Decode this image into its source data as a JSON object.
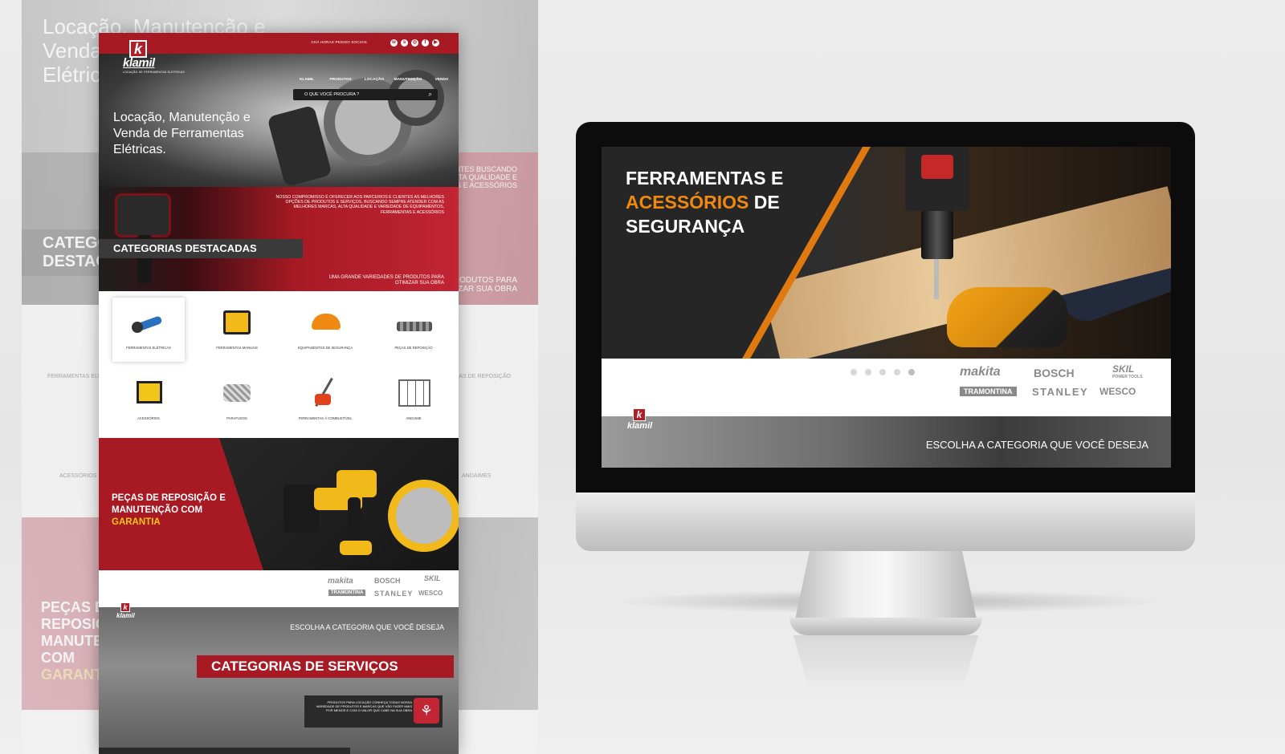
{
  "ghost": {
    "hero_title": "Locação, Manutenção e Venda de Ferramentas Elétricas.",
    "categories_title": "CATEGORIAS DESTACADAS",
    "red_text": "PARCEIROS E CLIENTES BUSCANDO SEMPRE ALTA QUALIDADE E FERRAMENTAS E ACESSÓRIOS",
    "red_text2": "VARIEDADES DE PRODUTOS PARA OTIMIZAR SUA OBRA",
    "labels": [
      "FERRAMENTAS ELÉTRICAS",
      "PEÇAS DE REPOSIÇÃO",
      "ACESSÓRIOS",
      "ANDAIMES"
    ],
    "parts_title": "PEÇAS DE REPOSIÇÃO E MANUTENÇÃO COM",
    "parts_gold": "GARANTIA"
  },
  "page": {
    "topbar_text": "CHÁ HORAS PEDIDO SOCIAIS",
    "social_icons": [
      "whatsapp-icon",
      "skype-icon",
      "instagram-icon",
      "facebook-icon",
      "youtube-icon"
    ],
    "social_glyphs": [
      "w",
      "s",
      "◎",
      "f",
      "▶"
    ],
    "logo": {
      "mark": "k",
      "name": "klamil",
      "tagline": "LOCAÇÃO DE FERRAMENTAS ELÉTRICAS"
    },
    "nav": [
      "KLAMIL",
      "PRODUTOS",
      "LOCAÇÃO",
      "MANUTENÇÃO",
      "VENDA"
    ],
    "search": {
      "placeholder": "O QUE VOCÊ PROCURA ?",
      "icon": "search-icon"
    },
    "hero_title": "Locação, Manutenção e Venda de Ferramentas Elétricas.",
    "red_text": "NOSSO COMPROMISSO É OFERECER AOS PARCEIROS E CLIENTES AS MELHORES OPÇÕES DE PRODUTOS E SERVIÇOS, BUSCANDO SEMPRE ATENDER COM AS MELHORES MARCAS, ALTA QUALIDADE E VARIEDADE DE EQUIPAMENTOS, FERRAMENTAS E ACESSÓRIOS",
    "categories_title": "CATEGORIAS DESTACADAS",
    "red_text2": "UMA GRANDE VARIEDADES DE PRODUTOS PARA OTIMIZAR SUA OBRA",
    "categories": [
      {
        "label": "FERRAMENTAS ELÉTRICAS",
        "icon": "angle-grinder-icon"
      },
      {
        "label": "FERRAMENTAS MANUAIS",
        "icon": "toolbox-icon"
      },
      {
        "label": "EQUIPAMENTOS DE SEGURANÇA",
        "icon": "safety-helmet-icon"
      },
      {
        "label": "PEÇAS DE REPOSIÇÃO",
        "icon": "spare-parts-icon"
      },
      {
        "label": "ACESSÓRIOS",
        "icon": "generator-icon"
      },
      {
        "label": "PARAFUSOS",
        "icon": "screws-icon"
      },
      {
        "label": "FERRAMENTAS À COMBUSTÍVEL",
        "icon": "brushcutter-icon"
      },
      {
        "label": "ANDAIME",
        "icon": "scaffold-icon"
      }
    ],
    "parts_title": "PEÇAS DE REPOSIÇÃO E MANUTENÇÃO COM",
    "parts_gold": "GARANTIA",
    "brands": [
      "makita",
      "BOSCH",
      "SKIL",
      "TRAMONTINA",
      "STANLEY",
      "WESCO"
    ],
    "cta_text": "ESCOLHA A CATEGORIA QUE VOCÊ DESEJA",
    "services_title": "CATEGORIAS DE SERVIÇOS",
    "services_box_text": "PRODUTOS PARA LOCAÇÃO CONHEÇA TODAS NOSSA VARIEDADE DE PRODUTOS E MARCAS QUE VÃO FAZER MAIS POR MENOS E COM O VALOR QUE CABE NA SUA OBRA"
  },
  "monitor": {
    "hero_title_1": "FERRAMENTAS E",
    "hero_title_org": "ACESSÓRIOS",
    "hero_title_2": "DE",
    "hero_title_3": "SEGURANÇA",
    "slider": {
      "count": 5,
      "active": 5
    },
    "brands": [
      "makita",
      "BOSCH",
      "SKIL",
      "TRAMONTINA",
      "STANLEY",
      "WESCO"
    ],
    "skil_sub": "POWER TOOLS",
    "logo": {
      "mark": "k",
      "name": "klamil"
    },
    "cta_text": "ESCOLHA A CATEGORIA QUE VOCÊ DESEJA"
  },
  "colors": {
    "brand_red": "#a71a24",
    "accent_orange": "#f0890f",
    "gold": "#f5c518"
  }
}
